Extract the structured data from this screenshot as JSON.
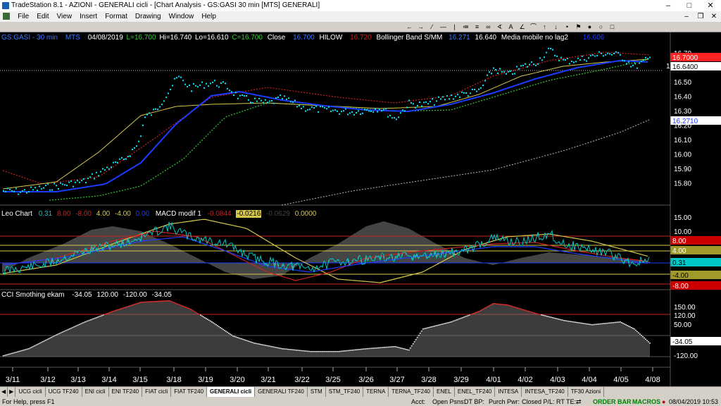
{
  "window": {
    "title": "TradeStation 8.1 - AZIONI - GENERALI cicli - [Chart Analysis - GS:GASI  30 min  [MTS] GENERALI]"
  },
  "menu": [
    "File",
    "Edit",
    "View",
    "Insert",
    "Format",
    "Drawing",
    "Window",
    "Help"
  ],
  "toolbar_icons": [
    "arrow-left-icon",
    "arrow-right-icon",
    "trendline-icon",
    "horizontal-line-icon",
    "vertical-line-icon",
    "fib-icon",
    "text-icon",
    "arrow-up-icon",
    "arrow-down-icon",
    "circle-icon",
    "ellipse-icon",
    "rectangle-icon"
  ],
  "header": {
    "symbol": "GS:GASI - 30 min",
    "exchange": "MTS",
    "date": "04/08/2019",
    "L": "L=16.700",
    "Hi": "Hi=16.740",
    "Lo": "Lo=16.610",
    "C": "C=16.700",
    "close_label": "Close",
    "close_val": "16.700",
    "hilow": "HILOW",
    "hilow_val": "16.720",
    "bb_label": "Bollinger Band S/MM",
    "bb_v1": "16.271",
    "bb_v2": "16.640",
    "mm_label": "Media mobile no lag2",
    "mm_val": "16.606"
  },
  "price_panel": {
    "current_line_label": "16.615",
    "axis_ticks": [
      "16.70",
      "16.60",
      "16.50",
      "16.40",
      "16.30",
      "16.20",
      "16.10",
      "16.00",
      "15.90",
      "15.80"
    ],
    "badges": {
      "last": "16.7000",
      "mid": "16.6400",
      "lower": "16.2710"
    }
  },
  "leo_panel": {
    "label": "Leo Chart",
    "v1": "0.31",
    "v2": "8.00",
    "v3": "-8.00",
    "v4": "4.00",
    "v5": "-4.00",
    "v6": "0.00",
    "macd_label": "MACD modif 1",
    "macd_v1": "-0.0844",
    "macd_v2": "-0.0216",
    "macd_v3": "-0.0629",
    "macd_v4": "0.0000",
    "axis_ticks": [
      "15.00",
      "10.00"
    ],
    "badges": {
      "b8": "8.00",
      "b4": "4.00",
      "b031": "0.31",
      "bm4": "-4.00",
      "bm8": "-8.00"
    }
  },
  "cci_panel": {
    "label": "CCI Smothing ekam",
    "v1": "-34.05",
    "v2": "120.00",
    "v3": "-120.00",
    "v4": "-34.05",
    "axis_ticks": [
      "150.00",
      "120.00",
      "50.00",
      "-34.05",
      "-120.00"
    ]
  },
  "x_axis": [
    "3/11",
    "3/12",
    "3/13",
    "3/14",
    "3/15",
    "3/18",
    "3/19",
    "3/20",
    "3/21",
    "3/22",
    "3/25",
    "3/26",
    "3/27",
    "3/28",
    "3/29",
    "4/01",
    "4/02",
    "4/03",
    "4/04",
    "4/05",
    "4/08"
  ],
  "tabs": [
    "UCG cicli",
    "UCG TF240",
    "ENI cicli",
    "ENI TF240",
    "FIAT cicli",
    "FIAT TF240",
    "GENERALI cicli",
    "GENERALI TF240",
    "STM",
    "STM_TF240",
    "TERNA",
    "TERNA_TF240",
    "ENEL",
    "ENEL_TF240",
    "INTESA",
    "INTESA_TF240",
    "TF30 Azioni"
  ],
  "active_tab": "GENERALI cicli",
  "status": {
    "help": "For Help, press F1",
    "acct": "Acct:",
    "open_psns": "Open Psns:",
    "dt_bp": "DT BP:",
    "purch_pwr": "Purch Pwr:",
    "closed_pl": "Closed P/L:",
    "rt_te": "RT TE:",
    "order_bar": "ORDER BAR",
    "macros": "MACROS",
    "datetime": "08/04/2019 10:53"
  },
  "colors": {
    "price_dots": "#00e5ff",
    "ma_yellow": "#d6c84a",
    "ma_blue": "#1a3cff",
    "ma_red_dotted": "#cc2222",
    "ma_green_dotted": "#33cc33",
    "ma_white_dotted": "#bbbbbb",
    "macd_yellow": "#d6c84a",
    "leo_cyan": "#00c8c8",
    "hist_gray": "#8a8a8a",
    "cci_white": "#d8d8d8"
  }
}
